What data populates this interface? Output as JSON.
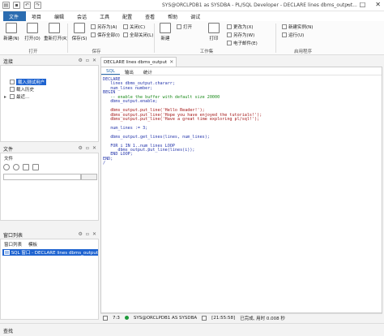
{
  "window": {
    "title": "SYS@ORCLPDB1 as SYSDBA - PL/SQL Developer - DECLARE lines dbms_output...",
    "controls": [
      "minimize-icon",
      "maximize-icon",
      "close-icon"
    ]
  },
  "menu": {
    "items": [
      "文件",
      "项目",
      "编辑",
      "会话",
      "工具",
      "配置",
      "查看",
      "帮助",
      "调试"
    ],
    "active_index": 0
  },
  "ribbon": {
    "groups": [
      {
        "label": "打开",
        "buttons": [
          "新建(N)",
          "打开(O)",
          "重新打开(R)"
        ]
      },
      {
        "label": "保存",
        "buttons": [
          "保存(S)",
          "另存为(A)",
          "保存全部(I)"
        ]
      },
      {
        "label": "",
        "buttons": [
          "关闭(C)",
          "全部关闭(L)"
        ]
      },
      {
        "label": "工作集",
        "buttons": [
          "新建",
          "打开",
          "打印",
          "更改为(X)",
          "另存为(W)",
          "电子邮件(E)"
        ]
      },
      {
        "label": "启用程序",
        "buttons": [
          "新建实例(N)",
          "运行(U)"
        ]
      }
    ]
  },
  "navigator": {
    "header": "连接",
    "tree": [
      {
        "label": "载入测试用户",
        "selected": true
      },
      {
        "label": "载入历史",
        "selected": false
      },
      {
        "label": "最近...",
        "selected": false
      }
    ]
  },
  "files": {
    "header": "文件",
    "tab": "文件",
    "input_value": ""
  },
  "windows": {
    "header": "窗口列表",
    "tabs": [
      "窗口列表",
      "模板"
    ],
    "active_window": "SQL 窗口 - DECLARE lines dbms_output"
  },
  "find_bar": {
    "label": "查找"
  },
  "document": {
    "tab_title": "DECLARE lines dbms_output",
    "sub_tabs": [
      "SQL",
      "输出",
      "统计"
    ],
    "code": [
      {
        "t": "DECLARE",
        "c": "kw"
      },
      {
        "t": "   lines dbms_output.chararr;",
        "c": "kw"
      },
      {
        "t": "   num_lines number;",
        "c": "kw"
      },
      {
        "t": "BEGIN",
        "c": "kw"
      },
      {
        "t": "   -- enable the buffer with default size 20000",
        "c": "cm"
      },
      {
        "t": "   dbms_output.enable;",
        "c": "kw"
      },
      {
        "t": "",
        "c": "kw"
      },
      {
        "t": "   dbms_output.put_line('Hello Reader!');",
        "c": "st"
      },
      {
        "t": "   dbms_output.put_line('Hope you have enjoyed the tutorials!');",
        "c": "st"
      },
      {
        "t": "   dbms_output.put_line('Have a great time exploring pl/sql!');",
        "c": "st"
      },
      {
        "t": "",
        "c": "kw"
      },
      {
        "t": "   num_lines := 3;",
        "c": "kw"
      },
      {
        "t": "",
        "c": "kw"
      },
      {
        "t": "   dbms_output.get_lines(lines, num_lines);",
        "c": "kw"
      },
      {
        "t": "",
        "c": "kw"
      },
      {
        "t": "   FOR i IN 1..num_lines LOOP",
        "c": "kw"
      },
      {
        "t": "      dbms_output.put_line(lines(i));",
        "c": "kw"
      },
      {
        "t": "   END LOOP;",
        "c": "kw"
      },
      {
        "t": "END;",
        "c": "kw"
      },
      {
        "t": "/",
        "c": "kw"
      }
    ]
  },
  "status": {
    "position": "7:3",
    "connection": "SYS@ORCLPDB1 AS SYSDBA",
    "time": "[21:55:58]",
    "message": "已完成, 用时 0.008 秒"
  }
}
